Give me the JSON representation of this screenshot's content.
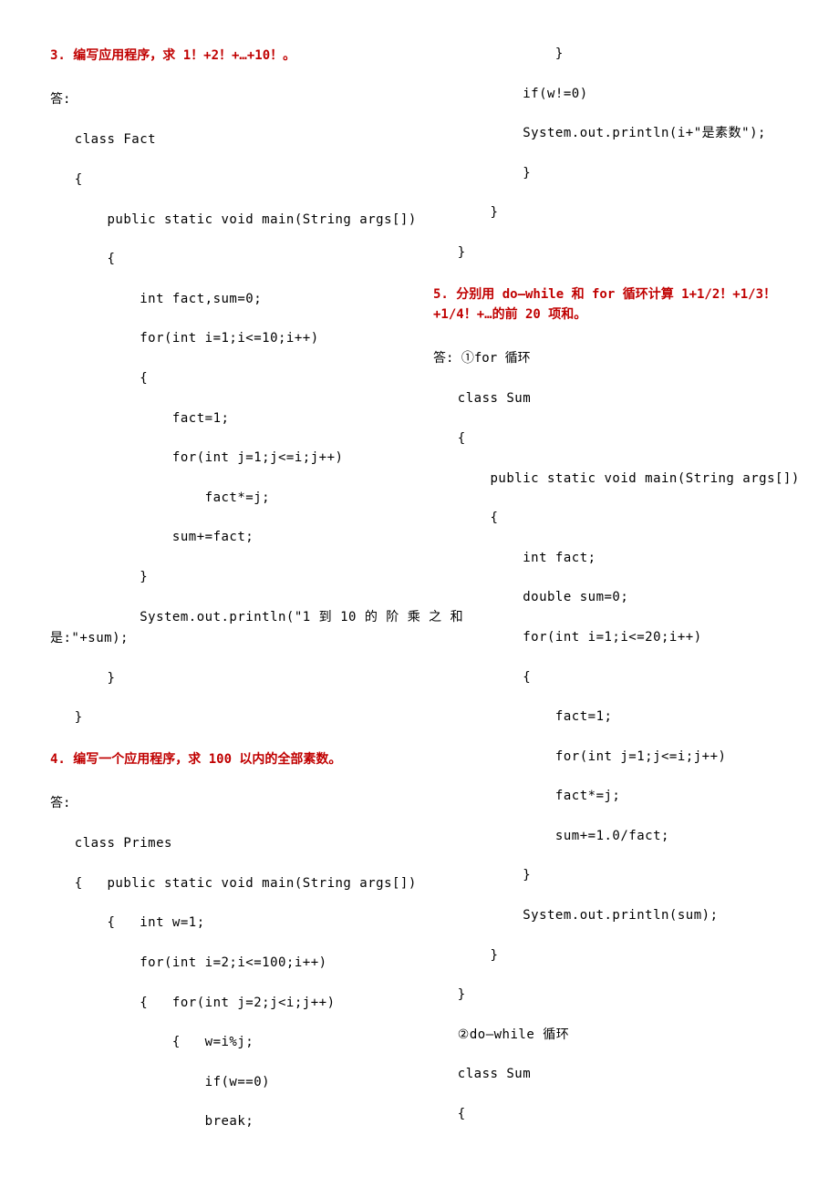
{
  "q3": {
    "title": "3. 编写应用程序，求 1！+2！+…+10！。",
    "ans_label": "答:",
    "code": [
      "   class Fact",
      "   {",
      "       public static void main(String args[])",
      "       {",
      "           int fact,sum=0;",
      "           for(int i=1;i<=10;i++)",
      "           {",
      "               fact=1;",
      "               for(int j=1;j<=i;j++)",
      "                   fact*=j;",
      "               sum+=fact;",
      "           }"
    ],
    "justify_line_prefix": "           System.out.println(\"1 到 10 的 阶 乘 之 和",
    "justify_line_tail": "是:\"+sum);",
    "code_tail": [
      "       }",
      "   }"
    ]
  },
  "q4": {
    "title": "4. 编写一个应用程序，求 100 以内的全部素数。",
    "ans_label": "答:",
    "code": [
      "   class Primes",
      "   {   public static void main(String args[])",
      "       {   int w=1;",
      "           for(int i=2;i<=100;i++)",
      "           {   for(int j=2;j<i;j++)",
      "               {   w=i%j;",
      "                   if(w==0)",
      "                   break;",
      "               }",
      "           if(w!=0)",
      "           System.out.println(i+\"是素数\");",
      "           }",
      "       }",
      "   }"
    ]
  },
  "q5": {
    "title": "5. 分别用 do—while 和 for 循环计算 1+1/2！+1/3！+1/4！+…的前 20 项和。",
    "ans_label": "答: ①for 循环",
    "code": [
      "   class Sum",
      "   {",
      "       public static void main(String args[])",
      "       {",
      "           int fact;",
      "           double sum=0;",
      "           for(int i=1;i<=20;i++)",
      "           {",
      "               fact=1;",
      "               for(int j=1;j<=i;j++)",
      "               fact*=j;",
      "               sum+=1.0/fact;",
      "           }",
      "           System.out.println(sum);",
      "       }",
      "   }",
      "   ②do—while 循环",
      "   class Sum",
      "   {"
    ]
  }
}
